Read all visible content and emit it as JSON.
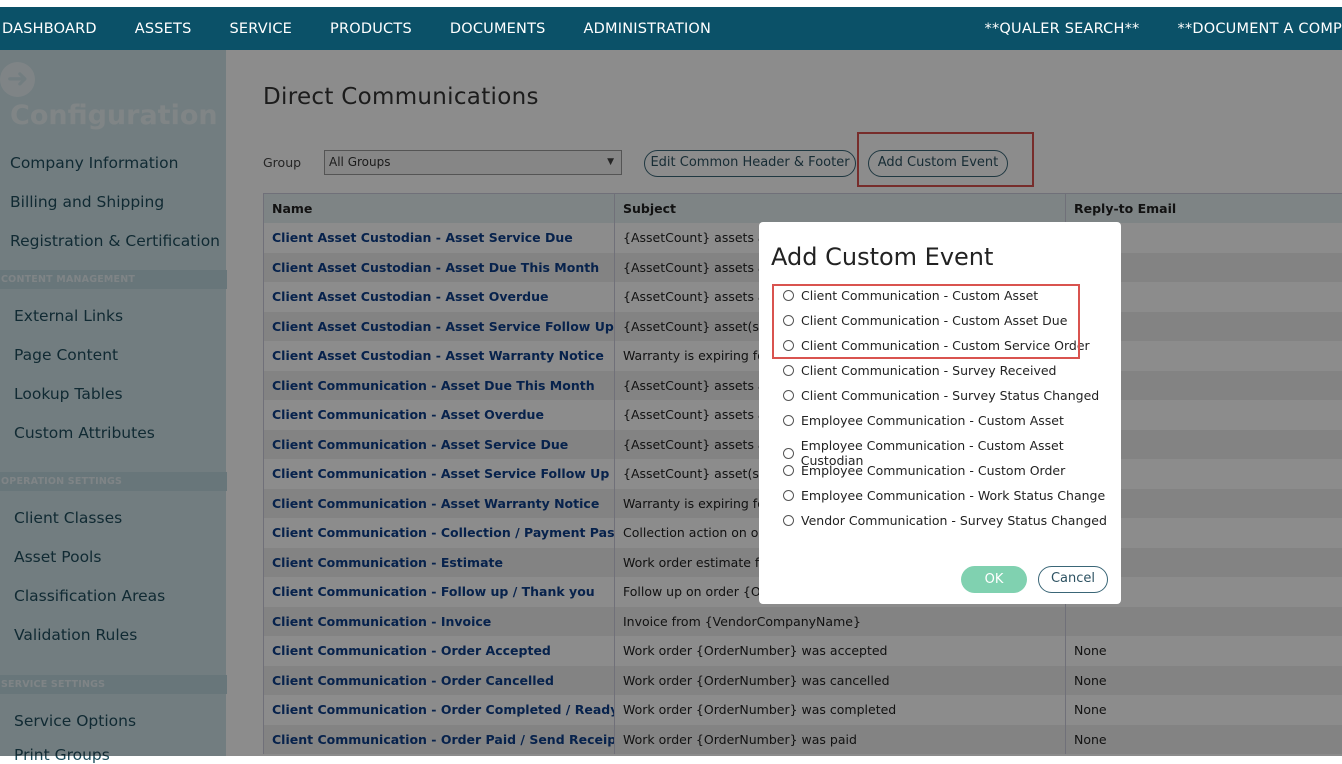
{
  "topnav": {
    "items": [
      "DASHBOARD",
      "ASSETS",
      "SERVICE",
      "PRODUCTS",
      "DOCUMENTS",
      "ADMINISTRATION"
    ],
    "right_items": [
      "**QUALER SEARCH**",
      "**DOCUMENT A COMP"
    ]
  },
  "sidebar": {
    "back_icon": "arrow-left-circle-icon",
    "title": "Configuration",
    "top_items": [
      "Company Information",
      "Billing and Shipping",
      "Registration & Certification"
    ],
    "content_section": "CONTENT MANAGEMENT",
    "content_items": [
      "External Links",
      "Page Content",
      "Lookup Tables",
      "Custom Attributes"
    ],
    "operation_section": "OPERATION SETTINGS",
    "operation_items": [
      "Client Classes",
      "Asset Pools",
      "Classification Areas",
      "Validation Rules"
    ],
    "service_section": "SERVICE SETTINGS",
    "service_items": [
      "Service Options",
      "Print Groups"
    ]
  },
  "main": {
    "title": "Direct Communications",
    "group_label": "Group",
    "group_value": "All Groups",
    "edit_header_footer_label": "Edit Common Header & Footer",
    "add_custom_event_label": "Add Custom Event",
    "columns": [
      "Name",
      "Subject",
      "Reply-to Email"
    ],
    "rows": [
      {
        "name": "Client Asset Custodian - Asset Service Due",
        "subject": "{AssetCount} assets are d",
        "reply": ""
      },
      {
        "name": "Client Asset Custodian - Asset Due This Month",
        "subject": "{AssetCount} assets are d",
        "reply": ""
      },
      {
        "name": "Client Asset Custodian - Asset Overdue",
        "subject": "{AssetCount} assets are o",
        "reply": ""
      },
      {
        "name": "Client Asset Custodian - Asset Service Follow Up",
        "subject": "{AssetCount} asset(s) serv",
        "reply": ""
      },
      {
        "name": "Client Asset Custodian - Asset Warranty Notice",
        "subject": "Warranty is expiring for {A",
        "reply": ""
      },
      {
        "name": "Client Communication - Asset Due This Month",
        "subject": "{AssetCount} assets are d",
        "reply": ""
      },
      {
        "name": "Client Communication - Asset Overdue",
        "subject": "{AssetCount} assets are o",
        "reply": ""
      },
      {
        "name": "Client Communication - Asset Service Due",
        "subject": "{AssetCount} assets are d",
        "reply": ""
      },
      {
        "name": "Client Communication - Asset Service Follow Up",
        "subject": "{AssetCount} asset(s) serv",
        "reply": ""
      },
      {
        "name": "Client Communication - Asset Warranty Notice",
        "subject": "Warranty is expiring for {A",
        "reply": ""
      },
      {
        "name": "Client Communication - Collection / Payment Past Due",
        "subject": "Collection action on orde",
        "reply": ""
      },
      {
        "name": "Client Communication - Estimate",
        "subject": "Work order estimate from",
        "reply": ""
      },
      {
        "name": "Client Communication - Follow up / Thank you",
        "subject": "Follow up on order {Orde",
        "reply": ""
      },
      {
        "name": "Client Communication - Invoice",
        "subject": "Invoice from {VendorCompanyName}",
        "reply": ""
      },
      {
        "name": "Client Communication - Order Accepted",
        "subject": "Work order {OrderNumber} was accepted",
        "reply": "None"
      },
      {
        "name": "Client Communication - Order Cancelled",
        "subject": "Work order {OrderNumber} was cancelled",
        "reply": "None"
      },
      {
        "name": "Client Communication - Order Completed / Ready For Sign off",
        "subject": "Work order {OrderNumber} was completed",
        "reply": "None"
      },
      {
        "name": "Client Communication - Order Paid / Send Receipt",
        "subject": "Work order {OrderNumber} was paid",
        "reply": "None"
      }
    ]
  },
  "dialog": {
    "title": "Add Custom Event",
    "options": [
      "Client Communication - Custom Asset",
      "Client Communication - Custom Asset Due",
      "Client Communication - Custom Service Order",
      "Client Communication - Survey Received",
      "Client Communication - Survey Status Changed",
      "Employee Communication - Custom Asset",
      "Employee Communication - Custom Asset Custodian",
      "Employee Communication - Custom Order",
      "Employee Communication - Work Status Change",
      "Vendor Communication - Survey Status Changed"
    ],
    "ok_label": "OK",
    "cancel_label": "Cancel"
  },
  "colors": {
    "nav_bg": "#0b5168",
    "sidebar_bg": "#cfe4ea",
    "highlight": "#d9534f",
    "link": "#0d3f8a",
    "ok_button": "#80d1b0"
  }
}
